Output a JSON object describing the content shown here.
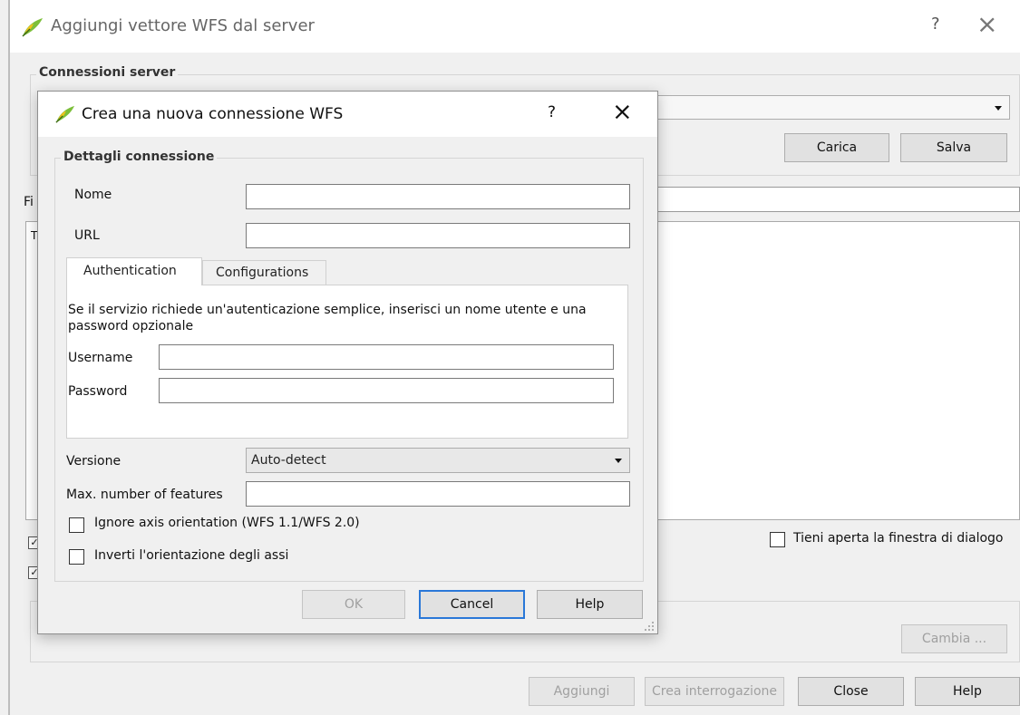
{
  "main_window": {
    "title": "Aggiungi vettore WFS dal server",
    "help_glyph": "?",
    "close_glyph": "×",
    "connections_group": "Connessioni server",
    "filter_label_partial": "Fi",
    "list_partial_text": "T",
    "load_button": "Carica",
    "save_button": "Salva",
    "keep_open_label": "Tieni aperta la finestra di dialogo",
    "change_button": "Cambia ...",
    "add_button": "Aggiungi",
    "build_query_button": "Crea interrogazione",
    "close_button": "Close",
    "help_button": "Help",
    "check_glyph": "✓"
  },
  "dialog": {
    "title": "Crea una nuova connessione WFS",
    "help_glyph": "?",
    "close_glyph": "×",
    "details_group": "Dettagli connessione",
    "name_label": "Nome",
    "name_value": "",
    "url_label": "URL",
    "url_value": "",
    "tabs": [
      {
        "label": "Authentication",
        "active": true
      },
      {
        "label": "Configurations",
        "active": false
      }
    ],
    "auth_description": "Se il servizio richiede un'autenticazione semplice, inserisci un nome utente e una password opzionale",
    "username_label": "Username",
    "username_value": "",
    "password_label": "Password",
    "password_value": "",
    "version_label": "Versione",
    "version_value": "Auto-detect",
    "max_features_label": "Max. number of features",
    "max_features_value": "",
    "ignore_axis_label": "Ignore axis orientation (WFS 1.1/WFS 2.0)",
    "invert_axis_label": "Inverti l'orientazione degli assi",
    "ok_button": "OK",
    "cancel_button": "Cancel",
    "help_button": "Help"
  },
  "colors": {
    "window_bg": "#f0f0f0",
    "accent": "#2a78d8",
    "qgis_green": "#7cbf3a",
    "qgis_yellow": "#f2c21b"
  }
}
